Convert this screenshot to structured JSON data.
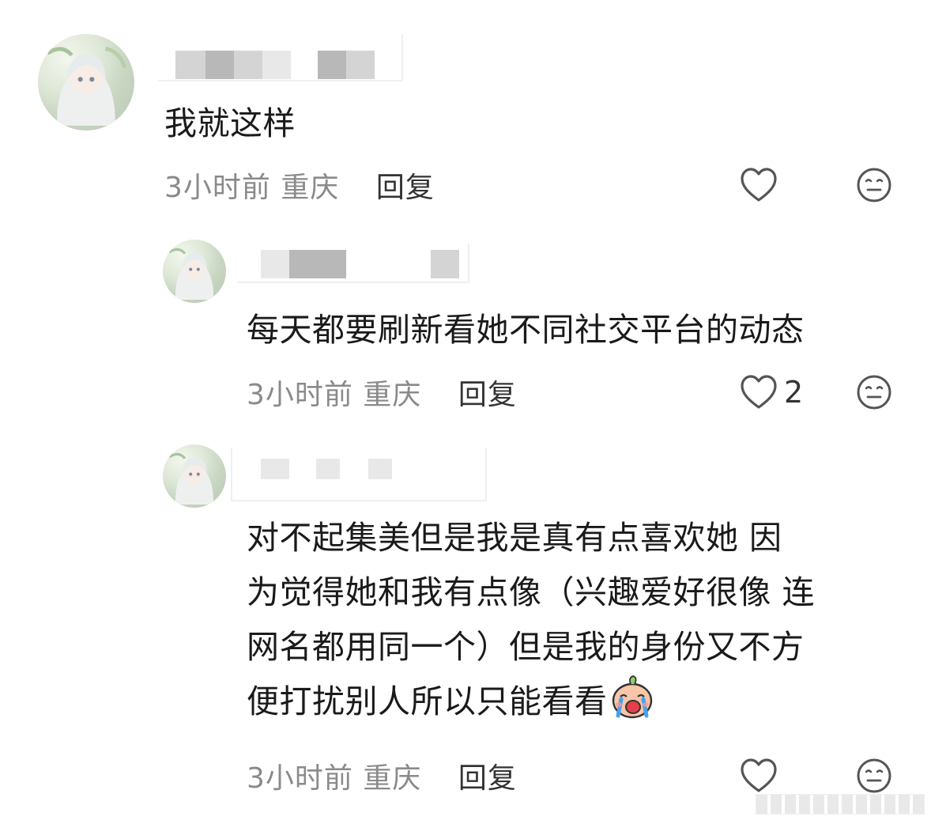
{
  "comments": [
    {
      "text": "我就这样",
      "time": "3小时前",
      "location": "重庆",
      "reply_label": "回复",
      "likes": ""
    },
    {
      "text": "每天都要刷新看她不同社交平台的动态",
      "time": "3小时前",
      "location": "重庆",
      "reply_label": "回复",
      "likes": "2"
    },
    {
      "lines": [
        "对不起集美但是我是真有点喜欢她 因",
        "为觉得她和我有点像（兴趣爱好很像 连",
        "网名都用同一个）但是我的身份又不方",
        "便打扰别人所以只能看看"
      ],
      "emoji": "crying-face-emoji",
      "time": "3小时前",
      "location": "重庆",
      "reply_label": "回复",
      "likes": ""
    }
  ],
  "icons": {
    "like": "heart-outline-icon",
    "dislike": "meh-face-icon"
  },
  "colors": {
    "text": "#1a1a1a",
    "meta": "#8a8a8a",
    "reply": "#333333",
    "icon": "#555555"
  }
}
